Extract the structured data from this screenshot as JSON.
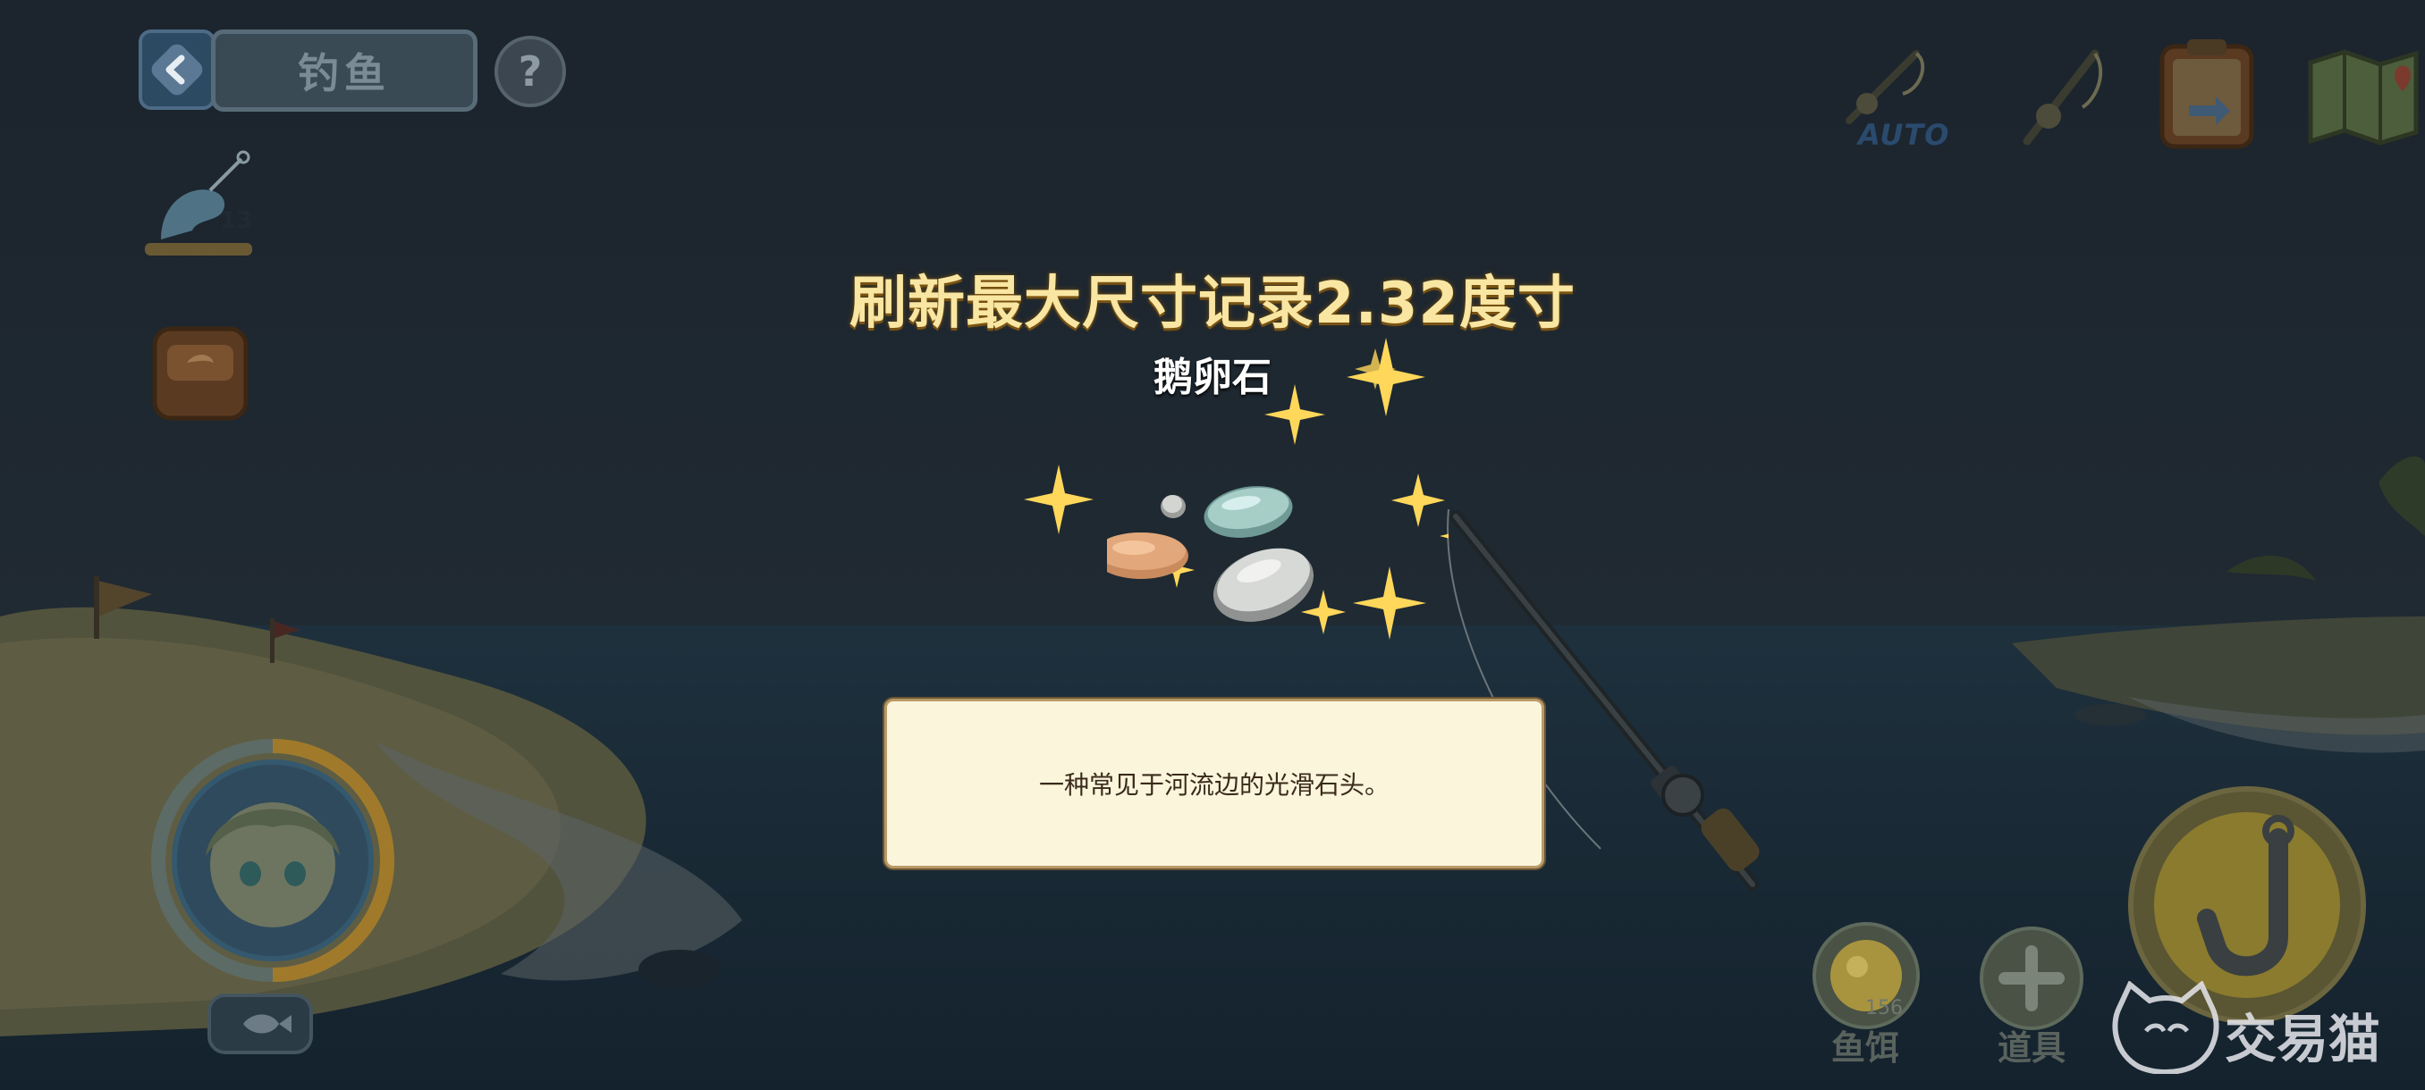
{
  "header": {
    "title": "钓鱼",
    "help_symbol": "?"
  },
  "sidebar": {
    "lure_count": "13"
  },
  "top_right": {
    "auto_label": "AUTO"
  },
  "catch": {
    "record_title": "刷新最大尺寸记录2.32度寸",
    "item_name": "鹅卵石",
    "description": "一种常见于河流边的光滑石头。"
  },
  "bottom_right": {
    "bait_label": "鱼饵",
    "bait_count": "156",
    "tool_label": "道具"
  },
  "watermark": {
    "text": "交易猫"
  },
  "colors": {
    "title_gold": "#f8e6a2",
    "panel_cream": "#fbf5dc",
    "sparkle": "#ffd75a"
  }
}
